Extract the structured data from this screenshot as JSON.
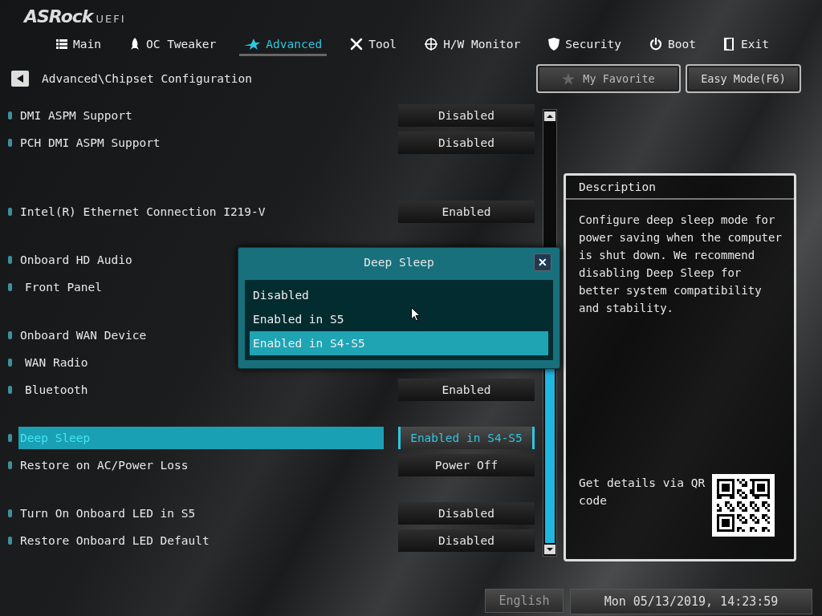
{
  "logo": {
    "brand": "ASRock",
    "suffix": "UEFI"
  },
  "tabs": [
    {
      "label": "Main",
      "selected": false
    },
    {
      "label": "OC Tweaker",
      "selected": false
    },
    {
      "label": "Advanced",
      "selected": true
    },
    {
      "label": "Tool",
      "selected": false
    },
    {
      "label": "H/W Monitor",
      "selected": false
    },
    {
      "label": "Security",
      "selected": false
    },
    {
      "label": "Boot",
      "selected": false
    },
    {
      "label": "Exit",
      "selected": false
    }
  ],
  "breadcrumb": "Advanced\\Chipset Configuration",
  "my_favorite": "My Favorite",
  "easy_mode": "Easy Mode(F6)",
  "settings": [
    [
      {
        "label": "DMI ASPM Support",
        "value": "Disabled",
        "selected": false
      },
      {
        "label": "PCH DMI ASPM Support",
        "value": "Disabled",
        "selected": false
      }
    ],
    [
      {
        "label": "Intel(R) Ethernet Connection I219-V",
        "value": "Enabled",
        "selected": false
      }
    ],
    [
      {
        "label": "Onboard HD Audio",
        "selected": false,
        "children": [
          {
            "label": "Front Panel",
            "selected": false
          }
        ]
      }
    ],
    [
      {
        "label": "Onboard WAN Device",
        "selected": false,
        "children": [
          {
            "label": "WAN Radio",
            "selected": false
          },
          {
            "label": "Bluetooth",
            "value": "Enabled",
            "selected": false
          }
        ]
      }
    ],
    [
      {
        "label": "Deep Sleep",
        "value": "Enabled in S4-S5",
        "selected": true
      },
      {
        "label": "Restore on AC/Power Loss",
        "value": "Power Off",
        "selected": false
      }
    ],
    [
      {
        "label": "Turn On Onboard LED in S5",
        "value": "Disabled",
        "selected": false
      },
      {
        "label": "Restore Onboard LED Default",
        "value": "Disabled",
        "selected": false
      }
    ]
  ],
  "description": {
    "title": "Description",
    "text": "Configure deep sleep mode for power saving when the computer is shut down. We recommend disabling Deep Sleep for better system compatibility and stability.",
    "qr_text": "Get details via QR code"
  },
  "popup": {
    "title": "Deep Sleep",
    "close": "✕",
    "options": [
      {
        "label": "Disabled",
        "selected": false
      },
      {
        "label": "Enabled in S5",
        "selected": false
      },
      {
        "label": "Enabled in S4-S5",
        "selected": true
      }
    ]
  },
  "status_bar": {
    "language": "English",
    "datetime": "Mon 05/13/2019, 14:23:59"
  }
}
